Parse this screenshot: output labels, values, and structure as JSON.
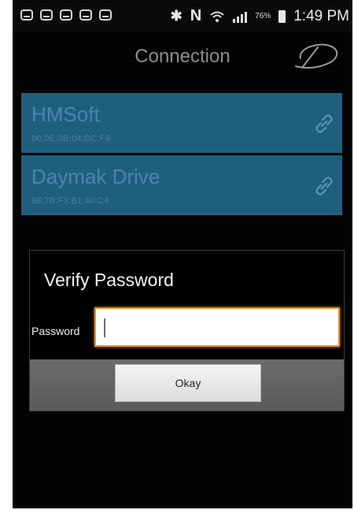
{
  "status_bar": {
    "notification_icons": [
      "message-icon",
      "message-icon",
      "message-icon",
      "message-icon",
      "message-icon"
    ],
    "bluetooth_icon": "bluetooth-icon",
    "nfc_icon": "nfc-icon",
    "wifi_icon": "wifi-icon",
    "signal_icon": "signal-icon",
    "battery_percent": "76%",
    "time": "1:49 PM"
  },
  "header": {
    "title": "Connection",
    "logo": "daymak-logo"
  },
  "devices": [
    {
      "name": "HMSoft",
      "address": "00:0E:0B:04:DC:F9"
    },
    {
      "name": "Daymak Drive",
      "address": "98:7B:F3:B1:40:C4"
    }
  ],
  "dialog": {
    "title": "Verify Password",
    "password_label": "Password",
    "password_value": "",
    "okay_label": "Okay"
  },
  "colors": {
    "device_background": "#1f5f7e",
    "device_text": "#4b85ad",
    "input_focus_border": "#e8902d",
    "dialog_footer": "#606060"
  }
}
